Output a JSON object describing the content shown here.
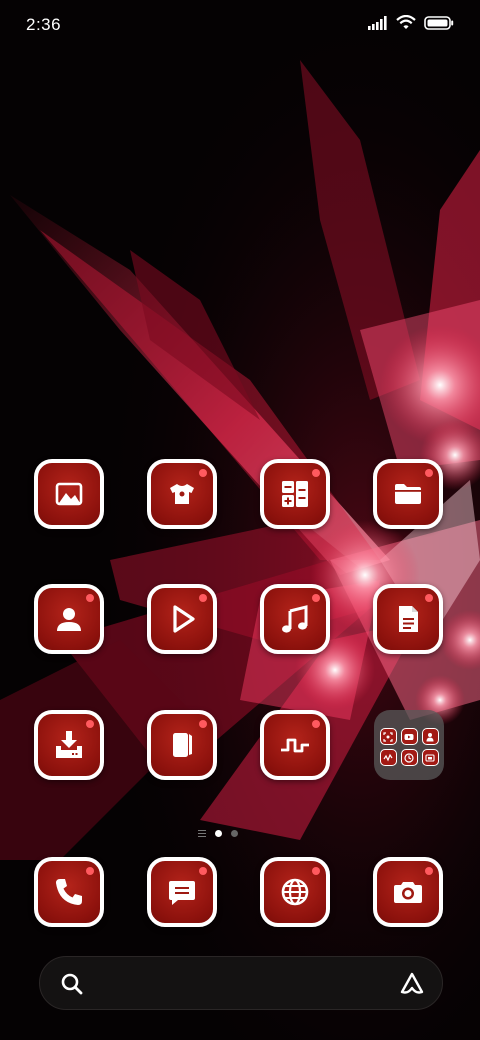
{
  "status_bar": {
    "time": "2:36",
    "icons": [
      "signal-icon",
      "wifi-icon",
      "battery-icon"
    ]
  },
  "theme": {
    "icon_fill": "#9e1911",
    "icon_border": "#ffffff",
    "badge_color": "#ff5a5f",
    "wallpaper_accent": "#e8264a"
  },
  "home": {
    "apps": [
      {
        "icon": "gallery-icon",
        "badge": true
      },
      {
        "icon": "themes-icon",
        "badge": true
      },
      {
        "icon": "calculator-icon",
        "badge": true
      },
      {
        "icon": "file-manager-icon",
        "badge": true
      },
      {
        "icon": "contacts-icon",
        "badge": true
      },
      {
        "icon": "video-player-icon",
        "badge": true
      },
      {
        "icon": "music-icon",
        "badge": true
      },
      {
        "icon": "notes-icon",
        "badge": true
      },
      {
        "icon": "downloads-icon",
        "badge": true
      },
      {
        "icon": "cleaner-icon",
        "badge": true
      },
      {
        "icon": "app-vault-icon",
        "badge": true
      }
    ],
    "folder": {
      "icons": [
        "screen-recorder-icon",
        "youtube-icon",
        "security-icon",
        "compass-icon",
        "clock-icon",
        "mi-video-icon"
      ]
    }
  },
  "page_indicator": {
    "pages": 2,
    "current": 1,
    "has_feed_page": true
  },
  "dock": {
    "apps": [
      {
        "icon": "phone-icon",
        "badge": true
      },
      {
        "icon": "messages-icon",
        "badge": true
      },
      {
        "icon": "browser-icon",
        "badge": true
      },
      {
        "icon": "camera-icon",
        "badge": true
      }
    ]
  },
  "search": {
    "placeholder": "",
    "left_icon": "search-icon",
    "right_icon": "assistant-icon"
  }
}
